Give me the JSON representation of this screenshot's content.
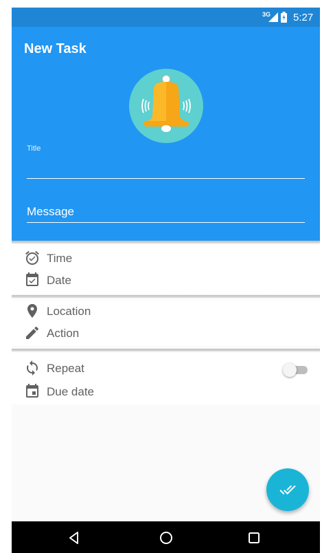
{
  "status_bar": {
    "network": "3G",
    "time": "5:27"
  },
  "header": {
    "title": "New Task",
    "title_field_label": "Title",
    "title_value": "",
    "message_placeholder": "Message"
  },
  "icons": {
    "illustration": "bell-icon",
    "fab": "done-all-icon",
    "nav": [
      "back-icon",
      "home-icon",
      "recents-icon"
    ]
  },
  "sections": {
    "when": [
      {
        "label": "Time",
        "icon": "alarm-icon"
      },
      {
        "label": "Date",
        "icon": "event-available-icon"
      }
    ],
    "what": [
      {
        "label": "Location",
        "icon": "place-icon"
      },
      {
        "label": "Action",
        "icon": "edit-icon"
      }
    ],
    "repeat": [
      {
        "label": "Repeat",
        "icon": "repeat-icon",
        "toggle_on": false
      },
      {
        "label": "Due date",
        "icon": "calendar-icon"
      }
    ]
  },
  "colors": {
    "primary": "#2196f3",
    "status_bar": "#1f86d6",
    "bell_bg": "#5ed0cf",
    "bell": "#fbb829",
    "fab": "#1ab5d6"
  }
}
